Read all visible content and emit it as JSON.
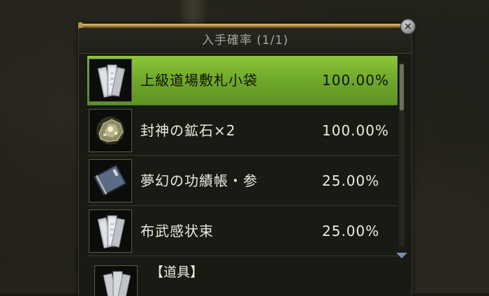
{
  "window": {
    "title": "入手確率 (1/1)"
  },
  "close_button": {
    "label": "×"
  },
  "items": [
    {
      "name": "上級道場敷札小袋",
      "rate": "100.00%",
      "icon": "scroll-bundle-icon",
      "selected": true
    },
    {
      "name": "封神の鉱石×2",
      "rate": "100.00%",
      "icon": "ore-icon",
      "selected": false
    },
    {
      "name": "夢幻の功績帳・参",
      "rate": "25.00%",
      "icon": "book-icon",
      "selected": false
    },
    {
      "name": "布武感状束",
      "rate": "25.00%",
      "icon": "scroll-bundle-icon",
      "selected": false
    }
  ],
  "category": {
    "label": "【道具】",
    "icon": "scroll-bundle-icon"
  },
  "colors": {
    "selected_row": "#7ab532",
    "panel_bg": "#181a14",
    "title_text": "#a7a692",
    "gold_trim": "#c8a855"
  }
}
